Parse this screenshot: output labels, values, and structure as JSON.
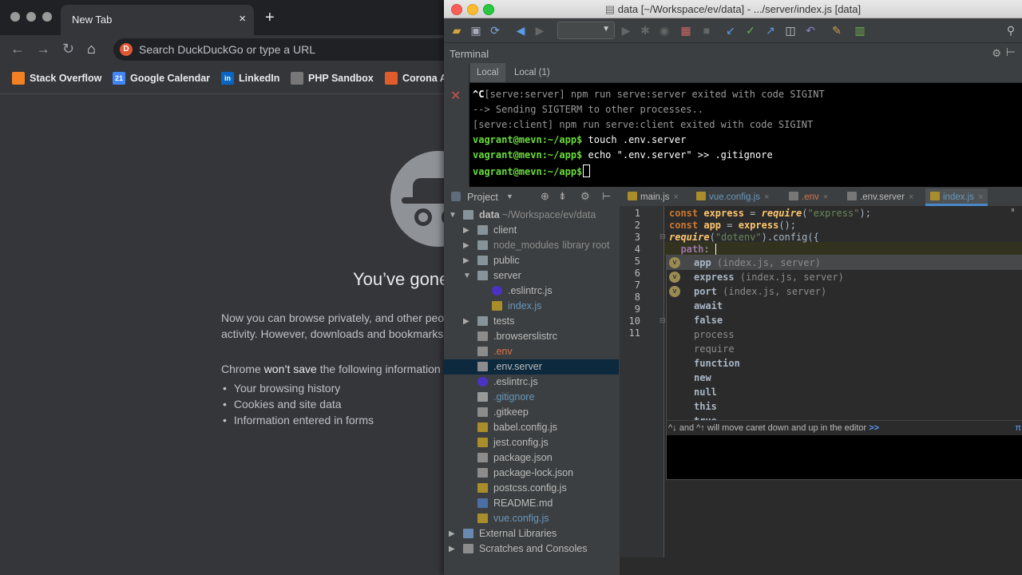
{
  "chrome": {
    "tab_title": "New Tab",
    "tab_close": "×",
    "new_tab": "+",
    "omnibox_placeholder": "Search DuckDuckGo or type a URL",
    "bookmarks": [
      {
        "label": "Stack Overflow",
        "color": "#f48024"
      },
      {
        "label": "Google Calendar",
        "color": "#4285f4",
        "badge": "21"
      },
      {
        "label": "LinkedIn",
        "color": "#0a66c2",
        "badge": "in"
      },
      {
        "label": "PHP Sandbox",
        "color": "#777777"
      },
      {
        "label": "Corona A",
        "color": "#e25b2a"
      }
    ],
    "incognito": {
      "title": "You’ve gone",
      "para1_line1": "Now you can browse privately, and other peop",
      "para1_line2": "activity. However, downloads and bookmarks",
      "para2_prefix": "Chrome ",
      "para2_bold": "won’t save",
      "para2_suffix": " the following information",
      "items": [
        "Your browsing history",
        "Cookies and site data",
        "Information entered in forms"
      ]
    }
  },
  "ide": {
    "window_title": "data [~/Workspace/ev/data] - .../server/index.js [data]",
    "terminal": {
      "title": "Terminal",
      "tabs": [
        "Local",
        "Local (1)"
      ],
      "lines": [
        {
          "prompt": "",
          "text": "^C",
          "rest": "[serve:server] npm run serve:server exited with code SIGINT"
        },
        {
          "prompt": "",
          "text": "",
          "rest": "--> Sending SIGTERM to other processes.."
        },
        {
          "prompt": "",
          "text": "",
          "rest": "[serve:client] npm run serve:client exited with code SIGINT"
        },
        {
          "prompt": "vagrant@mevn:~/app$",
          "text": " touch .env.server",
          "rest": ""
        },
        {
          "prompt": "vagrant@mevn:~/app$",
          "text": " echo \".env.server\" >> .gitignore",
          "rest": ""
        },
        {
          "prompt": "vagrant@mevn:~/app$",
          "text": "",
          "rest": ""
        }
      ]
    },
    "project": {
      "title": "Project",
      "items": [
        {
          "label": "data",
          "suffix": " ~/Workspace/ev/data",
          "depth": 0,
          "arrow": "▼",
          "type": "folder",
          "color": "#bbbbbb",
          "bold": true
        },
        {
          "label": "client",
          "depth": 1,
          "arrow": "▶",
          "type": "folder",
          "color": "#bbbbbb"
        },
        {
          "label": "node_modules",
          "suffix": "  library root",
          "depth": 1,
          "arrow": "▶",
          "type": "folder",
          "color": "#8c8c8c"
        },
        {
          "label": "public",
          "depth": 1,
          "arrow": "▶",
          "type": "folder",
          "color": "#bbbbbb"
        },
        {
          "label": "server",
          "depth": 1,
          "arrow": "▼",
          "type": "folder",
          "color": "#bbbbbb"
        },
        {
          "label": ".eslintrc.js",
          "depth": 2,
          "arrow": "",
          "type": "eslint",
          "color": "#bbbbbb"
        },
        {
          "label": "index.js",
          "depth": 2,
          "arrow": "",
          "type": "js",
          "color": "#6897bb"
        },
        {
          "label": "tests",
          "depth": 1,
          "arrow": "▶",
          "type": "folder",
          "color": "#bbbbbb"
        },
        {
          "label": ".browserslistrc",
          "depth": 1,
          "arrow": "",
          "type": "text",
          "color": "#bbbbbb"
        },
        {
          "label": ".env",
          "depth": 1,
          "arrow": "",
          "type": "text",
          "color": "#d9734a"
        },
        {
          "label": ".env.server",
          "depth": 1,
          "arrow": "",
          "type": "text",
          "color": "#bbbbbb",
          "selected": true
        },
        {
          "label": ".eslintrc.js",
          "depth": 1,
          "arrow": "",
          "type": "eslint",
          "color": "#bbbbbb"
        },
        {
          "label": ".gitignore",
          "depth": 1,
          "arrow": "",
          "type": "git",
          "color": "#6897bb"
        },
        {
          "label": ".gitkeep",
          "depth": 1,
          "arrow": "",
          "type": "text",
          "color": "#bbbbbb"
        },
        {
          "label": "babel.config.js",
          "depth": 1,
          "arrow": "",
          "type": "js",
          "color": "#bbbbbb"
        },
        {
          "label": "jest.config.js",
          "depth": 1,
          "arrow": "",
          "type": "js",
          "color": "#bbbbbb"
        },
        {
          "label": "package.json",
          "depth": 1,
          "arrow": "",
          "type": "json",
          "color": "#bbbbbb"
        },
        {
          "label": "package-lock.json",
          "depth": 1,
          "arrow": "",
          "type": "json",
          "color": "#bbbbbb"
        },
        {
          "label": "postcss.config.js",
          "depth": 1,
          "arrow": "",
          "type": "js",
          "color": "#bbbbbb"
        },
        {
          "label": "README.md",
          "depth": 1,
          "arrow": "",
          "type": "md",
          "color": "#bbbbbb"
        },
        {
          "label": "vue.config.js",
          "depth": 1,
          "arrow": "",
          "type": "js",
          "color": "#6897bb"
        },
        {
          "label": "External Libraries",
          "depth": 0,
          "arrow": "▶",
          "type": "lib",
          "color": "#bbbbbb"
        },
        {
          "label": "Scratches and Consoles",
          "depth": 0,
          "arrow": "▶",
          "type": "scratch",
          "color": "#bbbbbb"
        }
      ]
    },
    "editor_tabs": [
      {
        "label": "main.js",
        "color": "#bbbbbb"
      },
      {
        "label": "vue.config.js",
        "color": "#6897bb"
      },
      {
        "label": ".env",
        "color": "#d9734a"
      },
      {
        "label": ".env.server",
        "color": "#bbbbbb"
      },
      {
        "label": "index.js",
        "color": "#6897bb",
        "active": true
      }
    ],
    "line_numbers": [
      "1",
      "2",
      "3",
      "4",
      "5",
      "6",
      "7",
      "8",
      "9",
      "10",
      "11"
    ],
    "completion": {
      "items": [
        {
          "name": "app",
          "hint": " (index.js, server)",
          "icon": "v",
          "selected": true
        },
        {
          "name": "express",
          "hint": " (index.js, server)",
          "icon": "v"
        },
        {
          "name": "port",
          "hint": " (index.js, server)",
          "icon": "v"
        },
        {
          "name": "await",
          "hint": "",
          "icon": ""
        },
        {
          "name": "false",
          "hint": "",
          "icon": ""
        },
        {
          "name": "process",
          "hint": "",
          "icon": "",
          "dim": true
        },
        {
          "name": "require",
          "hint": "",
          "icon": "",
          "dim": true
        },
        {
          "name": "function",
          "hint": "",
          "icon": ""
        },
        {
          "name": "new",
          "hint": "",
          "icon": ""
        },
        {
          "name": "null",
          "hint": "",
          "icon": ""
        },
        {
          "name": "this",
          "hint": "",
          "icon": ""
        },
        {
          "name": "true",
          "hint": "",
          "icon": ""
        }
      ],
      "hint_prefix": "^↓ and ^↑ will move caret down and up in the editor ",
      "hint_link": ">>",
      "pi": "π"
    }
  }
}
